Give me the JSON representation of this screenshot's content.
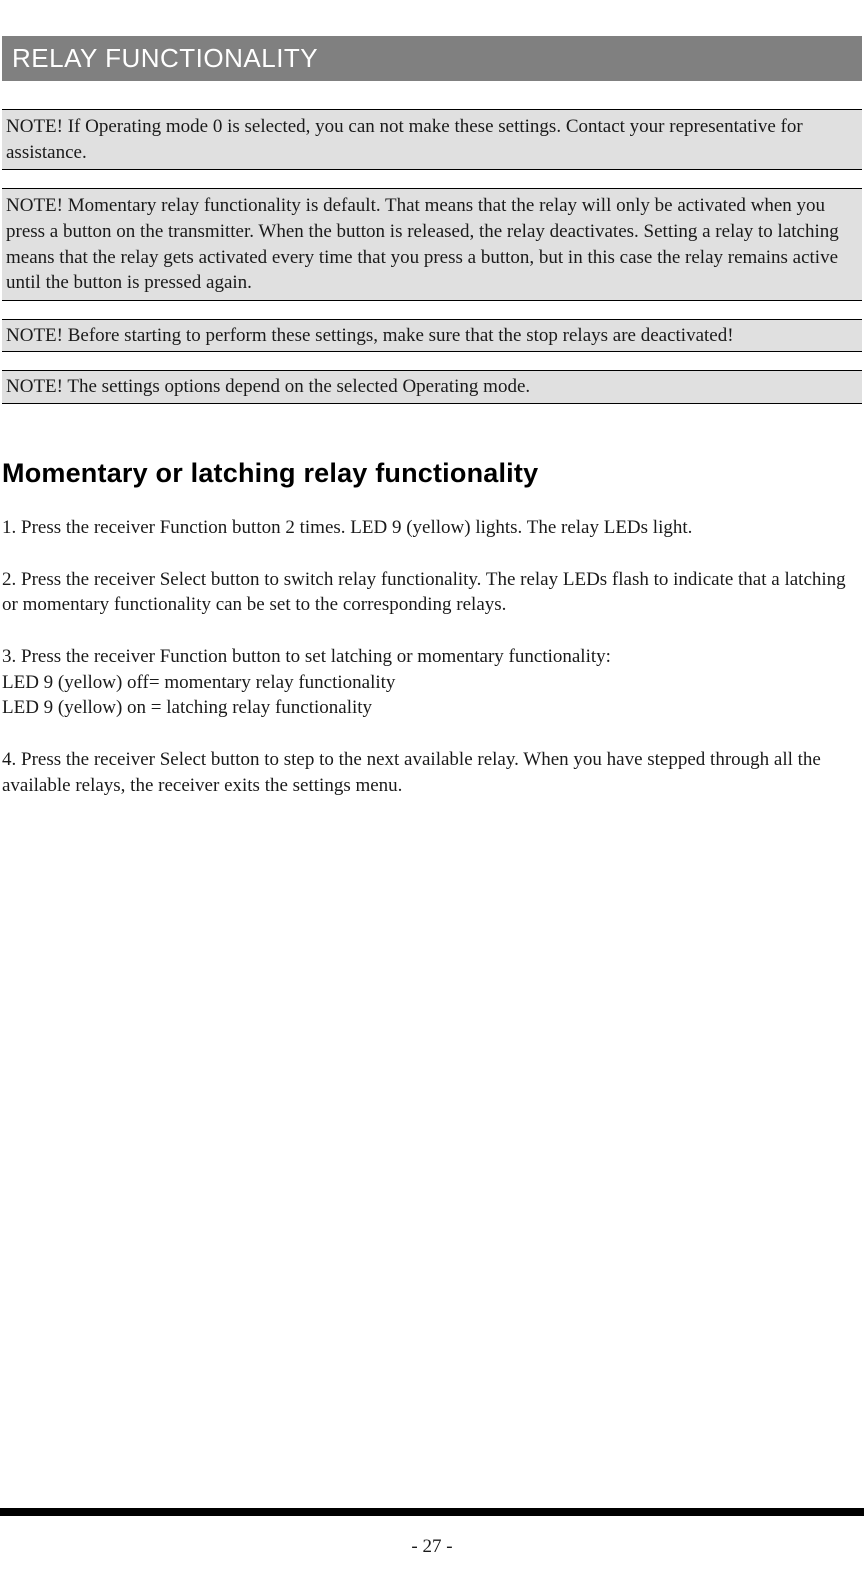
{
  "section_title": "RELAY FUNCTIONALITY",
  "notes": {
    "note1": "NOTE! If Operating mode 0 is selected, you can not make these settings. Contact your representative for assistance.",
    "note2": "NOTE! Momentary relay functionality is default. That means that the relay will only be activated when you press a button on the transmitter. When the button is released, the relay deactivates. Setting a relay to latching means that the relay gets activated every time that you press a button, but in this case the relay remains active until the button is pressed again.",
    "note3": "NOTE! Before starting to perform these settings, make sure that the stop relays are deactivated!",
    "note4": "NOTE! The settings options depend on the selected Operating mode."
  },
  "subheading": "Momentary or latching relay functionality",
  "steps": {
    "step1": "1. Press the receiver Function button 2 times. LED 9 (yellow) lights. The relay LEDs light.",
    "step2": "2. Press the receiver Select button to switch relay functionality. The relay LEDs flash to indicate that a latching or momentary functionality can be set to the corresponding relays.",
    "step3_line1": "3. Press the receiver Function button to set latching or momentary functionality:",
    "step3_line2": "LED 9 (yellow) off= momentary relay functionality",
    "step3_line3": "LED 9 (yellow) on = latching relay functionality",
    "step4": "4. Press the receiver Select button to step to the next available relay. When you have stepped through all the available relays, the receiver exits the settings menu."
  },
  "page_number": "- 27 -"
}
